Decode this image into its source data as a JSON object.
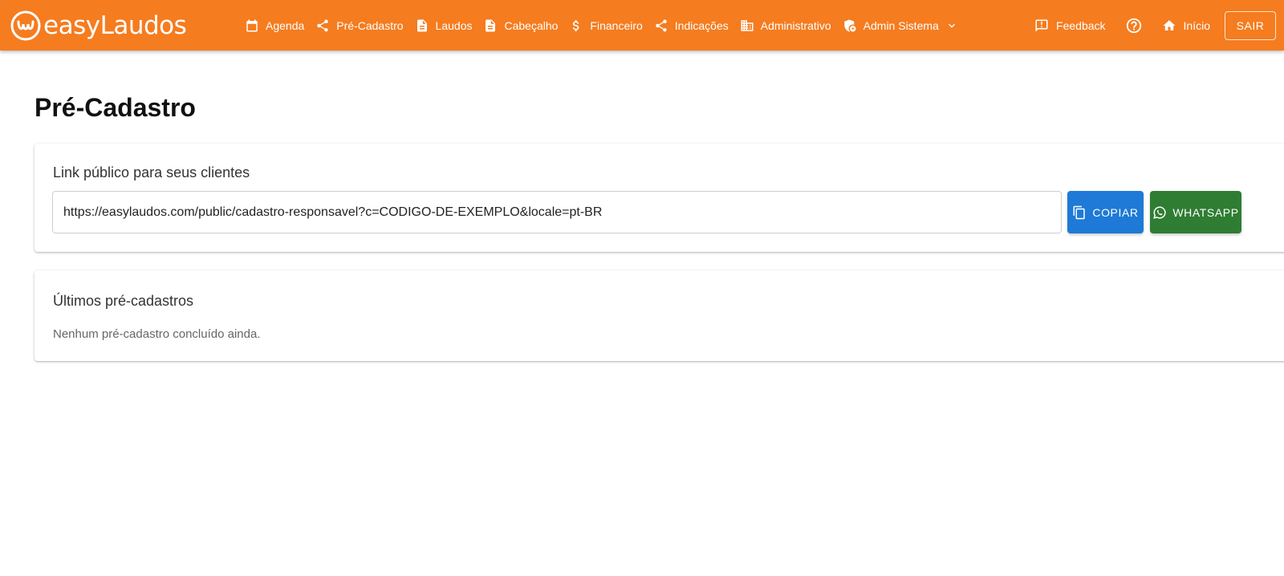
{
  "app": {
    "logo_text": "easyLaudos",
    "brand_color": "#f57c1f"
  },
  "nav": {
    "items": [
      {
        "label": "Agenda",
        "icon": "calendar-icon"
      },
      {
        "label": "Pré-Cadastro",
        "icon": "share-icon"
      },
      {
        "label": "Laudos",
        "icon": "document-icon"
      },
      {
        "label": "Cabeçalho",
        "icon": "document-icon"
      },
      {
        "label": "Financeiro",
        "icon": "dollar-icon"
      },
      {
        "label": "Indicações",
        "icon": "share-icon"
      },
      {
        "label": "Administrativo",
        "icon": "building-icon"
      },
      {
        "label": "Admin Sistema",
        "icon": "admin-shield-icon",
        "dropdown": true
      }
    ]
  },
  "right_nav": {
    "feedback_label": "Feedback",
    "home_label": "Início",
    "logout_label": "SAIR"
  },
  "page": {
    "title": "Pré-Cadastro"
  },
  "public_link_card": {
    "title": "Link público para seus clientes",
    "link_value": "https://easylaudos.com/public/cadastro-responsavel?c=CODIGO-DE-EXEMPLO&locale=pt-BR",
    "copy_label": "COPIAR",
    "copy_color": "#1e7ad6",
    "whatsapp_label": "WHATSAPP",
    "whatsapp_color": "#2e7d32"
  },
  "recent_card": {
    "title": "Últimos pré-cadastros",
    "empty_message": "Nenhum pré-cadastro concluído ainda."
  }
}
